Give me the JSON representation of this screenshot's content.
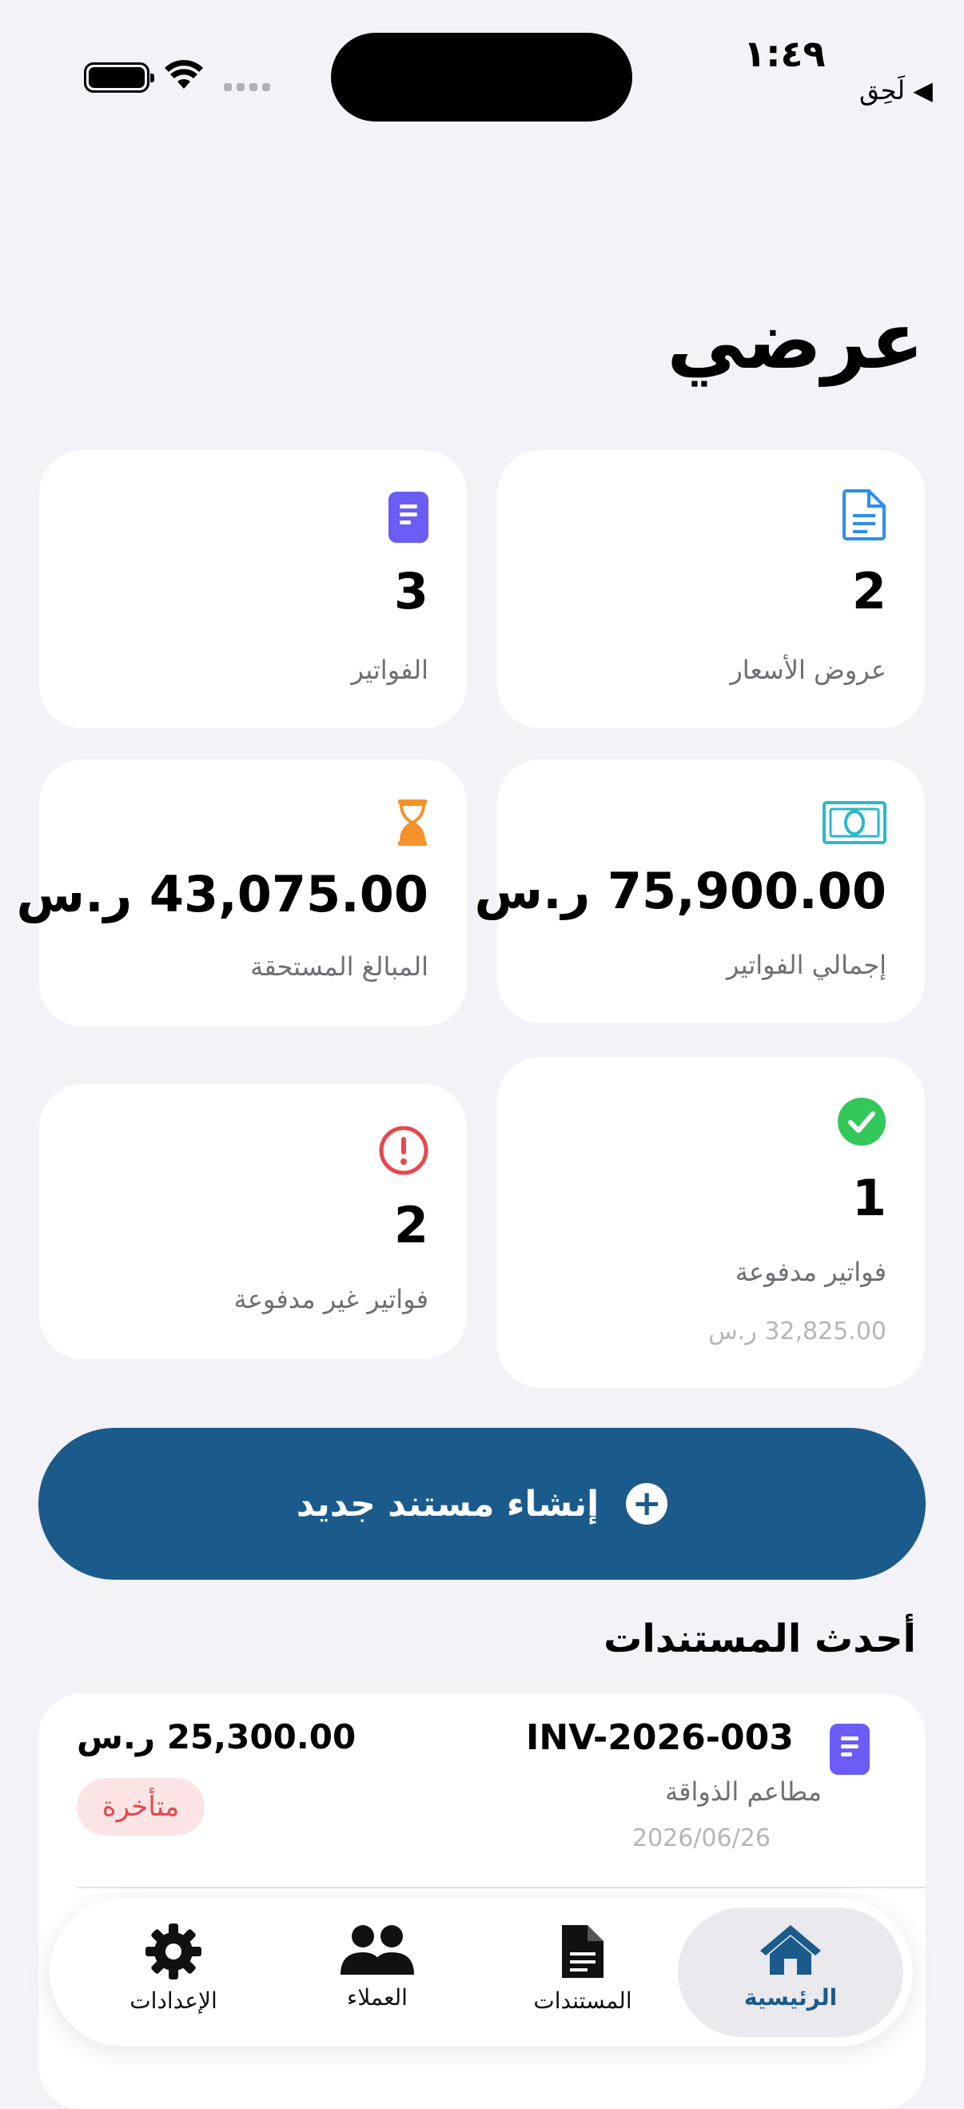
{
  "status_bar": {
    "time": "١:٤٩",
    "back_label": "◀ لَحِق"
  },
  "page_title": "عرضي",
  "stats": {
    "quotes": {
      "value": "2",
      "label": "عروض الأسعار"
    },
    "invoices": {
      "value": "3",
      "label": "الفواتير"
    },
    "total_invoices": {
      "value": "75,900.00 ر.س",
      "label": "إجمالي الفواتير"
    },
    "amounts_due": {
      "value": "43,075.00 ر.س",
      "label": "المبالغ المستحقة"
    },
    "paid_invoices": {
      "value": "1",
      "label": "فواتير مدفوعة",
      "sub": "32,825.00 ر.س"
    },
    "unpaid_invoices": {
      "value": "2",
      "label": "فواتير غير مدفوعة"
    }
  },
  "create_button": {
    "label": "إنشاء مستند جديد"
  },
  "recent": {
    "title": "أحدث المستندات",
    "items": [
      {
        "number": "INV-2026-003",
        "client": "مطاعم الذواقة",
        "date": "2026/06/26",
        "amount": "25,300.00 ر.س",
        "status": "متأخرة"
      }
    ]
  },
  "tabbar": {
    "items": [
      {
        "label": "الرئيسية",
        "icon": "house-icon",
        "active": true
      },
      {
        "label": "المستندات",
        "icon": "document-icon",
        "active": false
      },
      {
        "label": "العملاء",
        "icon": "people-icon",
        "active": false
      },
      {
        "label": "الإعدادات",
        "icon": "gear-icon",
        "active": false
      }
    ]
  },
  "colors": {
    "primary": "#1b5b8c",
    "quotes_icon": "#2b8ff0",
    "invoices_icon": "#6b5cf6",
    "money_icon": "#2bb8c9",
    "due_icon": "#f5922b",
    "paid_icon": "#34c759",
    "unpaid_icon": "#e5484d"
  }
}
